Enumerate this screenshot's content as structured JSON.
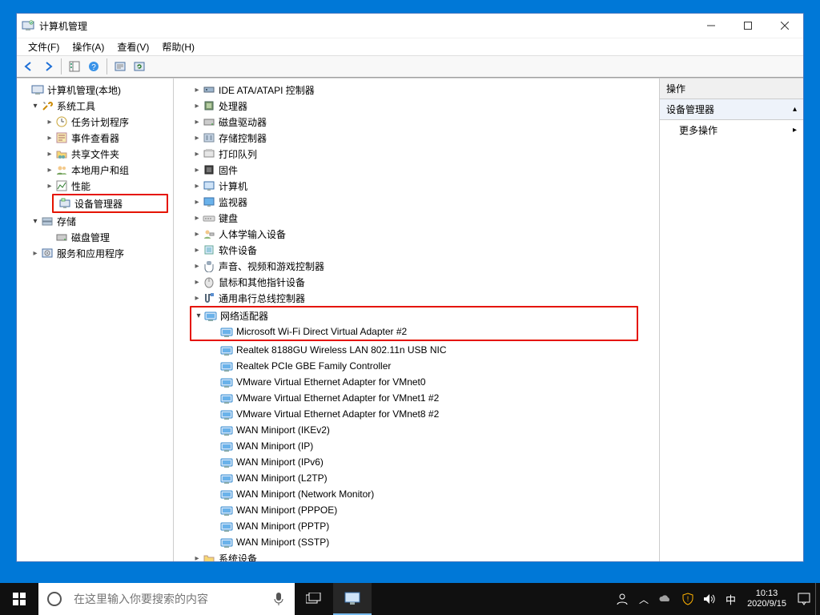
{
  "window": {
    "title": "计算机管理"
  },
  "menubar": [
    "文件(F)",
    "操作(A)",
    "查看(V)",
    "帮助(H)"
  ],
  "left_tree": {
    "root": "计算机管理(本地)",
    "system_tools": {
      "label": "系统工具",
      "children": [
        "任务计划程序",
        "事件查看器",
        "共享文件夹",
        "本地用户和组",
        "性能",
        "设备管理器"
      ]
    },
    "storage": {
      "label": "存储",
      "children": [
        "磁盘管理"
      ]
    },
    "services": {
      "label": "服务和应用程序"
    }
  },
  "device_categories": [
    "IDE ATA/ATAPI 控制器",
    "处理器",
    "磁盘驱动器",
    "存储控制器",
    "打印队列",
    "固件",
    "计算机",
    "监视器",
    "键盘",
    "人体学输入设备",
    "软件设备",
    "声音、视频和游戏控制器",
    "鼠标和其他指针设备",
    "通用串行总线控制器"
  ],
  "network_adapters": {
    "label": "网络适配器",
    "items": [
      "Microsoft Wi-Fi Direct Virtual Adapter #2",
      "Realtek 8188GU Wireless LAN 802.11n USB NIC",
      "Realtek PCIe GBE Family Controller",
      "VMware Virtual Ethernet Adapter for VMnet0",
      "VMware Virtual Ethernet Adapter for VMnet1 #2",
      "VMware Virtual Ethernet Adapter for VMnet8 #2",
      "WAN Miniport (IKEv2)",
      "WAN Miniport (IP)",
      "WAN Miniport (IPv6)",
      "WAN Miniport (L2TP)",
      "WAN Miniport (Network Monitor)",
      "WAN Miniport (PPPOE)",
      "WAN Miniport (PPTP)",
      "WAN Miniport (SSTP)"
    ]
  },
  "device_categories_after": [
    "系统设备"
  ],
  "actions": {
    "header": "操作",
    "group": "设备管理器",
    "more": "更多操作"
  },
  "taskbar": {
    "search_placeholder": "在这里输入你要搜索的内容",
    "ime": "中",
    "time": "10:13",
    "date": "2020/9/15"
  },
  "colors": {
    "accent": "#0078d7",
    "highlight_border": "#e51400"
  }
}
